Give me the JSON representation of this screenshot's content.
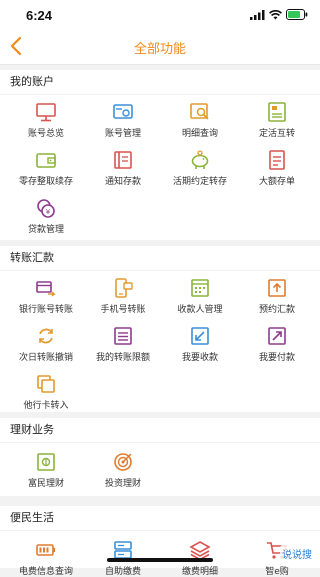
{
  "status_bar": {
    "time": "6:24"
  },
  "nav": {
    "title": "全部功能"
  },
  "colors": {
    "accent": "#f08a1c",
    "red": "#d9534f",
    "blue": "#3a8fd8",
    "green": "#8ab43a",
    "gold": "#e09b2d",
    "purple": "#8e3b8e"
  },
  "sections": [
    {
      "title": "我的账户",
      "items": [
        {
          "label": "账号总览",
          "icon": "monitor-icon"
        },
        {
          "label": "账号管理",
          "icon": "card-settings-icon"
        },
        {
          "label": "明细查询",
          "icon": "search-list-icon"
        },
        {
          "label": "定活互转",
          "icon": "transfer-doc-icon"
        },
        {
          "label": "零存整取续存",
          "icon": "wallet-icon"
        },
        {
          "label": "通知存款",
          "icon": "book-icon"
        },
        {
          "label": "活期约定转存",
          "icon": "piggy-bank-icon"
        },
        {
          "label": "大额存单",
          "icon": "document-icon"
        },
        {
          "label": "贷款管理",
          "icon": "coins-icon"
        }
      ]
    },
    {
      "title": "转账汇款",
      "items": [
        {
          "label": "银行账号转账",
          "icon": "bank-card-transfer-icon"
        },
        {
          "label": "手机号转账",
          "icon": "phone-transfer-icon"
        },
        {
          "label": "收款人管理",
          "icon": "payee-calendar-icon"
        },
        {
          "label": "预约汇款",
          "icon": "upload-box-icon"
        },
        {
          "label": "次日转账撤销",
          "icon": "refresh-icon"
        },
        {
          "label": "我的转账限额",
          "icon": "list-box-icon"
        },
        {
          "label": "我要收款",
          "icon": "receive-arrow-icon"
        },
        {
          "label": "我要付款",
          "icon": "pay-arrow-icon"
        },
        {
          "label": "他行卡转入",
          "icon": "copy-icon"
        }
      ]
    },
    {
      "title": "理财业务",
      "items": [
        {
          "label": "富民理财",
          "icon": "safe-box-icon"
        },
        {
          "label": "投资理财",
          "icon": "target-icon"
        }
      ]
    },
    {
      "title": "便民生活",
      "items": [
        {
          "label": "电费信息查询",
          "icon": "battery-icon"
        },
        {
          "label": "自助缴费",
          "icon": "server-icon"
        },
        {
          "label": "缴费明细",
          "icon": "stack-icon"
        },
        {
          "label": "智e购",
          "icon": "cart-icon"
        }
      ]
    }
  ],
  "watermark": "说说搜"
}
